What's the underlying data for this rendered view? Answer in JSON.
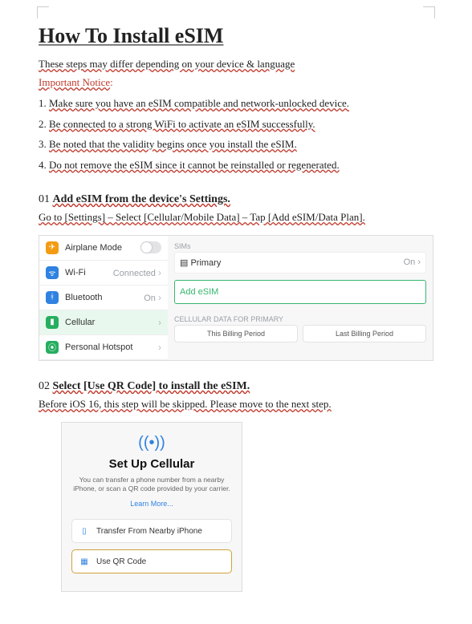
{
  "title": "How To Install eSIM",
  "intro": "These steps may differ depending on your device & language",
  "noticeLabel": "Important Notice",
  "notice": [
    "Make sure you have an eSIM compatible and network-unlocked device.",
    "Be connected to a strong WiFi to activate an eSIM successfully.",
    "Be noted that the validity begins once you install the eSIM.",
    "Do not remove the eSIM since it cannot be reinstalled or regenerated."
  ],
  "step1": {
    "num": "01",
    "title": "Add eSIM from the device's Settings.",
    "sub": "Go to [Settings] – Select [Cellular/Mobile Data] – Tap [Add eSIM/Data Plan].",
    "rows": {
      "airplane": "Airplane Mode",
      "wifi": "Wi-Fi",
      "wifiStatus": "Connected",
      "bt": "Bluetooth",
      "btStatus": "On",
      "cell": "Cellular",
      "hotspot": "Personal Hotspot"
    },
    "right": {
      "sims": "SIMs",
      "primary": "Primary",
      "primaryStatus": "On",
      "add": "Add eSIM",
      "dataFor": "CELLULAR DATA FOR PRIMARY",
      "seg1": "This Billing Period",
      "seg2": "Last Billing Period"
    }
  },
  "step2": {
    "num": "02",
    "title": "Select [Use QR Code] to install the eSIM.",
    "sub": "Before iOS 16, this step will be skipped. Please move to the next step.",
    "card": {
      "heading": "Set Up Cellular",
      "desc": "You can transfer a phone number from a nearby iPhone, or scan a QR code provided by your carrier.",
      "learn": "Learn More...",
      "opt1": "Transfer From Nearby iPhone",
      "opt2": "Use QR Code"
    }
  }
}
